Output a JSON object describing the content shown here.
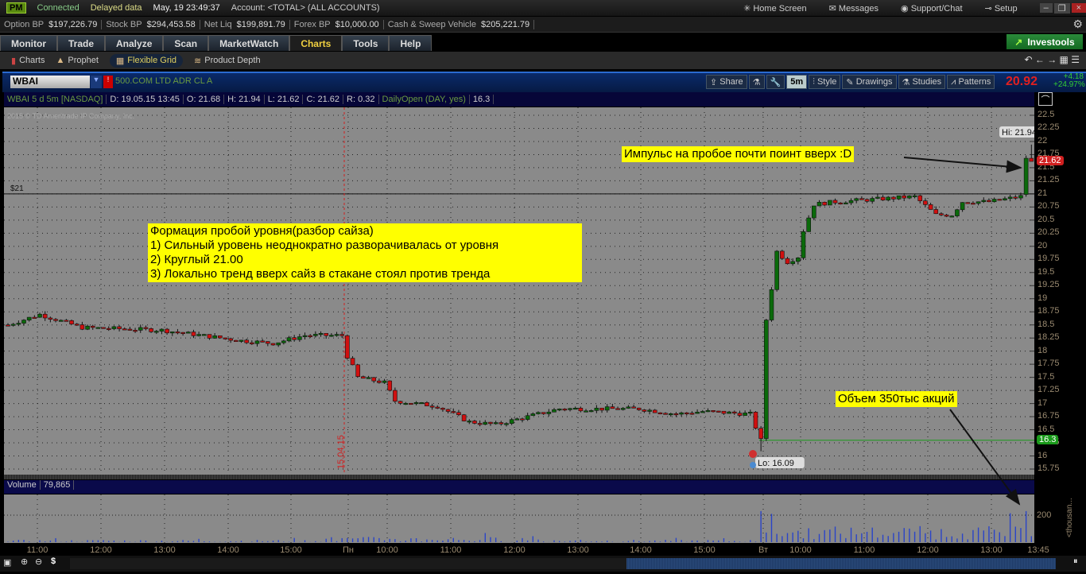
{
  "top": {
    "logo": "PM",
    "connected": "Connected",
    "delayed": "Delayed data",
    "datetime": "May, 19  23:49:37",
    "account": "Account: <TOTAL> (ALL ACCOUNTS)",
    "home": "Home Screen",
    "messages": "Messages",
    "support": "Support/Chat",
    "setup": "Setup"
  },
  "balances": [
    {
      "label": "Option BP",
      "value": "$197,226.79"
    },
    {
      "label": "Stock BP",
      "value": "$294,453.58"
    },
    {
      "label": "Net Liq",
      "value": "$199,891.79"
    },
    {
      "label": "Forex BP",
      "value": "$10,000.00"
    },
    {
      "label": "Cash & Sweep Vehicle",
      "value": "$205,221.79"
    }
  ],
  "tabs": [
    "Monitor",
    "Trade",
    "Analyze",
    "Scan",
    "MarketWatch",
    "Charts",
    "Tools",
    "Help"
  ],
  "active_tab": "Charts",
  "investools": "Investools",
  "subtabs": [
    "Charts",
    "Prophet",
    "Flexible Grid",
    "Product Depth"
  ],
  "chart_header": {
    "symbol": "WBAI",
    "description": "500.COM LTD ADR CL A",
    "share": "Share",
    "interval": "5m",
    "style": "Style",
    "drawings": "Drawings",
    "studies": "Studies",
    "patterns": "Patterns",
    "last": "20.92",
    "change": "+4.18",
    "change_pct": "+24.97%"
  },
  "info": [
    "WBAI 5 d 5m [NASDAQ]",
    "D: 19.05.15 13:45",
    "O: 21.68",
    "H: 21.94",
    "L: 21.62",
    "C: 21.62",
    "R: 0.32",
    "DailyOpen (DAY, yes)",
    "16.3"
  ],
  "copyright": "2015 © TD Ameritrade IP Company, Inc.",
  "colors": {
    "up": "#0a6a0a",
    "down": "#d01010",
    "annotation": "#ffff00",
    "plot_bg": "#8a8a8a"
  },
  "chart_data": {
    "type": "candlestick",
    "symbol": "WBAI",
    "aggregation": "5m",
    "days": 5,
    "ylim": [
      15.75,
      22.5
    ],
    "yticks": [
      "22.5",
      "22.25",
      "22",
      "21.75",
      "21.5",
      "21.25",
      "21",
      "20.75",
      "20.5",
      "20.25",
      "20",
      "19.75",
      "19.5",
      "19.25",
      "19",
      "18.75",
      "18.5",
      "18.25",
      "18",
      "17.75",
      "17.5",
      "17.25",
      "17",
      "16.75",
      "16.5",
      "16.25",
      "16",
      "15.75"
    ],
    "xticks": [
      "11:00",
      "12:00",
      "13:00",
      "14:00",
      "15:00",
      "Пн",
      "10:00",
      "11:00",
      "12:00",
      "13:00",
      "14:00",
      "15:00",
      "Вт",
      "10:00",
      "11:00",
      "12:00",
      "13:00",
      "13:45"
    ],
    "price_path": [
      [
        0,
        18.5
      ],
      [
        6,
        18.7
      ],
      [
        14,
        18.45
      ],
      [
        29,
        18.4
      ],
      [
        44,
        18.2
      ],
      [
        50,
        18.15
      ],
      [
        56,
        18.3
      ],
      [
        63,
        18.3
      ],
      [
        64,
        17.9
      ],
      [
        66,
        17.5
      ],
      [
        71,
        17.4
      ],
      [
        73,
        17.05
      ],
      [
        81,
        16.95
      ],
      [
        87,
        16.65
      ],
      [
        92,
        16.6
      ],
      [
        98,
        16.75
      ],
      [
        104,
        16.9
      ],
      [
        111,
        16.9
      ],
      [
        119,
        16.9
      ],
      [
        126,
        16.8
      ],
      [
        131,
        16.85
      ],
      [
        140,
        16.8
      ],
      [
        142,
        16.3
      ],
      [
        143,
        18.6
      ],
      [
        144,
        19.2
      ],
      [
        145,
        19.9
      ],
      [
        147,
        19.7
      ],
      [
        149,
        19.8
      ],
      [
        150,
        20.3
      ],
      [
        152,
        20.8
      ],
      [
        156,
        20.85
      ],
      [
        164,
        20.9
      ],
      [
        171,
        20.95
      ],
      [
        175,
        20.6
      ],
      [
        178,
        20.6
      ],
      [
        180,
        20.85
      ],
      [
        185,
        20.85
      ],
      [
        191,
        20.95
      ],
      [
        192,
        21.68
      ],
      [
        193,
        21.62
      ]
    ],
    "level_line": {
      "label": "$21",
      "value": 21
    },
    "daily_open": 16.3,
    "hi_label": "Hi: 21.94",
    "lo_label": "Lo: 16.09",
    "last_price_label": "21.62",
    "daily_open_label": "16.3",
    "date_marker": "15.04.15",
    "volume": {
      "label": "Volume",
      "value": "79,865",
      "ylim": [
        0,
        260
      ],
      "ytick": "200",
      "unit": "<thousan...",
      "spikes": [
        [
          142,
          230
        ],
        [
          192,
          230
        ]
      ]
    }
  },
  "annotations": {
    "main": [
      "Формация пробой уровня(разбор сайза)",
      "1) Сильный уровень неоднократно разворачивалась от уровня",
      "2) Круглый 21.00",
      "3) Локально тренд вверх сайз в стакане стоял против тренда"
    ],
    "impulse": "Импульс на пробое почти поинт вверх :D",
    "volume": "Объем 350тыс акций"
  }
}
